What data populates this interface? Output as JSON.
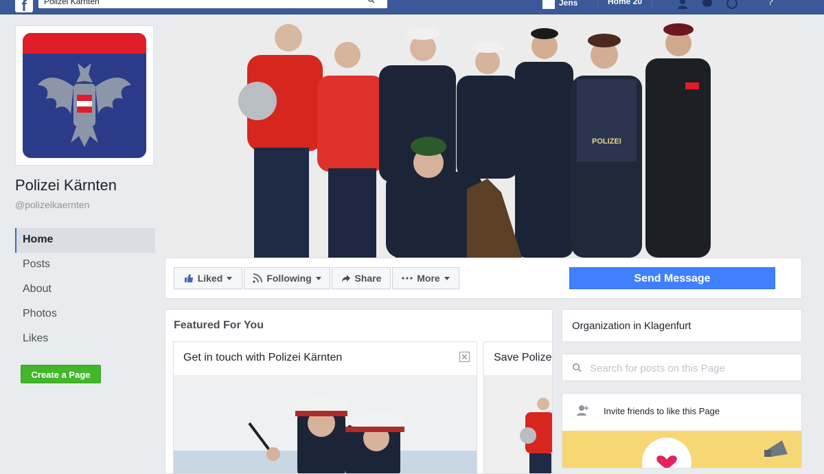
{
  "topbar": {
    "logo_letter": "f",
    "search_value": "Polizei Kärnten",
    "user_name": "Jens",
    "home_label": "Home 20",
    "help_label": "?"
  },
  "page": {
    "name": "Polizei Kärnten",
    "handle": "@polizeikaernten",
    "colors": {
      "fb_blue": "#3b5998",
      "accent": "#4080ff",
      "green": "#42b72a",
      "logo_red": "#e11d2a",
      "logo_blue": "#2b3b8a"
    }
  },
  "sidebar": {
    "items": [
      {
        "label": "Home",
        "active": true
      },
      {
        "label": "Posts"
      },
      {
        "label": "About"
      },
      {
        "label": "Photos"
      },
      {
        "label": "Likes"
      }
    ],
    "create_page_label": "Create a Page"
  },
  "cover": {
    "badge_text": "POLIZEI"
  },
  "actions": {
    "liked_label": "Liked",
    "following_label": "Following",
    "share_label": "Share",
    "more_label": "More",
    "send_message_label": "Send Message"
  },
  "featured": {
    "title": "Featured For You",
    "card1_title": "Get in touch with Polizei Kärnten",
    "card2_title": "Save Polizei"
  },
  "right_column": {
    "org_text": "Organization in Klagenfurt",
    "search_placeholder": "Search for posts on this Page",
    "invite_text": "Invite friends to like this Page"
  },
  "icons": [
    "search-icon",
    "thumbs-up-icon",
    "rss-icon",
    "share-arrow-icon",
    "more-dots-icon",
    "caret-down-icon",
    "close-icon",
    "add-person-icon",
    "heart-icon",
    "eagle-emblem-icon"
  ]
}
